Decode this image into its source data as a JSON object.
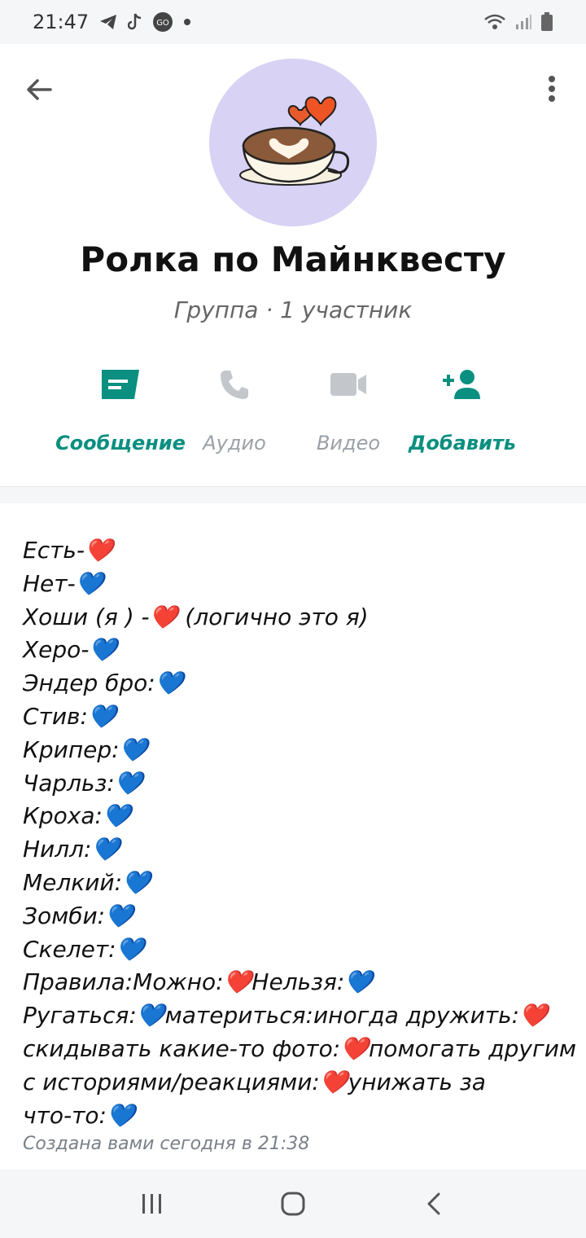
{
  "status_bar": {
    "time": "21:47",
    "icons": [
      "telegram-icon",
      "tiktok-icon",
      "go-icon",
      "dot-icon"
    ],
    "right_icons": [
      "wifi-icon",
      "signal-icon",
      "battery-icon"
    ]
  },
  "header": {
    "group_name": "Ролка по Майнквесту",
    "subtitle": "Группа · 1 участник",
    "avatar": "coffee-hearts-avatar"
  },
  "actions": [
    {
      "label": "Сообщение",
      "icon": "message-icon",
      "enabled": true
    },
    {
      "label": "Аудио",
      "icon": "phone-icon",
      "enabled": false
    },
    {
      "label": "Видео",
      "icon": "video-icon",
      "enabled": false
    },
    {
      "label": "Добавить",
      "icon": "add-person-icon",
      "enabled": true
    }
  ],
  "description": {
    "lines": [
      "Есть-❤️",
      "Нет-💙",
      "Хоши (я ) -❤️ (логично это я)",
      "Херо-💙",
      "Эндер бро:💙",
      "Стив:💙",
      "Крипер:💙",
      "Чарльз:💙",
      "Кроха:💙",
      "Нилл:💙",
      "Мелкий:💙",
      "Зомби:💙",
      "Скелет:💙",
      "Правила:Можно:❤️Нельзя:💙",
      "Ругаться:💙материться:иногда дружить:❤️",
      "скидывать какие-то фото:❤️помогать другим",
      "с историями/реакциями:❤️унижать за",
      "что-то:💙"
    ],
    "created": "Создана вами сегодня в 21:38"
  },
  "colors": {
    "accent": "#0a8f80",
    "disabled": "#c3c7cc",
    "avatar_bg": "#d8d2f4"
  }
}
